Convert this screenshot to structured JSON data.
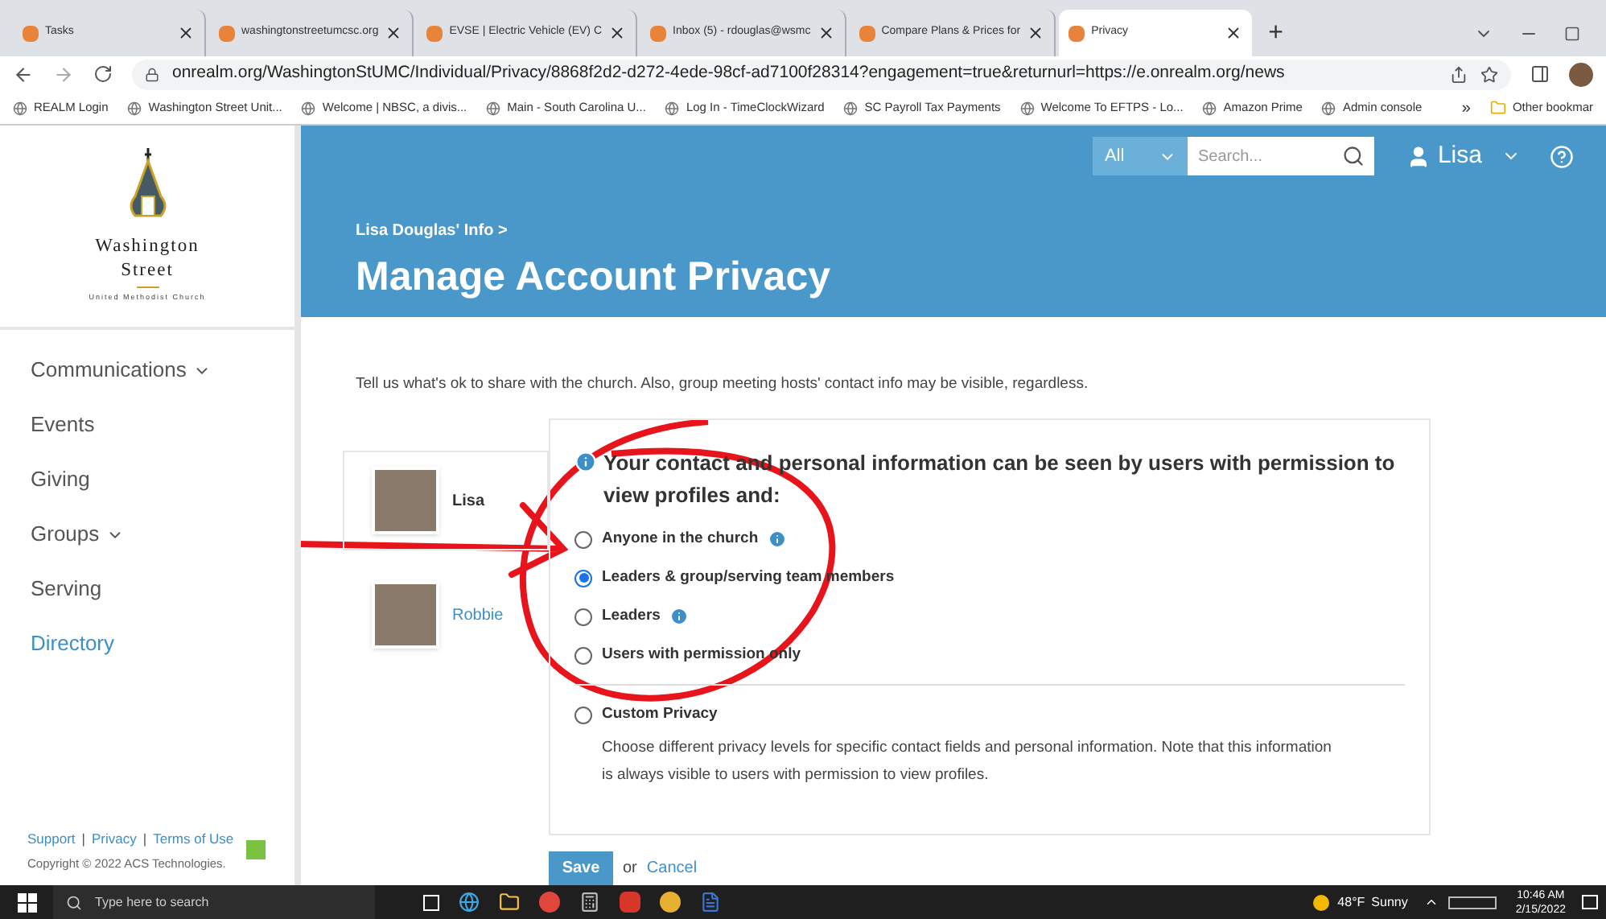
{
  "browser": {
    "tabs": [
      {
        "label": "Tasks",
        "selected": false
      },
      {
        "label": "washingtonstreetumcsc.org",
        "selected": false
      },
      {
        "label": "EVSE | Electric Vehicle (EV) C",
        "selected": false
      },
      {
        "label": "Inbox (5) - rdouglas@wsmc",
        "selected": false
      },
      {
        "label": "Compare Plans & Prices for",
        "selected": false
      },
      {
        "label": "Privacy",
        "selected": true
      }
    ],
    "new_tab": "+",
    "url": "onrealm.org/WashingtonStUMC/Individual/Privacy/8868f2d2-d272-4ede-98cf-ad7100f28314?engagement=true&returnurl=https://e.onrealm.org/news",
    "bookmarks": [
      "REALM Login",
      "Washington Street Unit...",
      "Welcome | NBSC, a divis...",
      "Main - South Carolina U...",
      "Log In - TimeClockWizard",
      "SC Payroll Tax Payments",
      "Welcome To EFTPS - Lo...",
      "Amazon Prime",
      "Admin console"
    ],
    "bookmarks_more": "»",
    "other_bookmarks": "Other bookmar"
  },
  "logo": {
    "line1": "Washington",
    "line2": "Street",
    "line3": "United Methodist Church"
  },
  "sidebar": {
    "items": [
      {
        "label": "Communications",
        "expandable": true,
        "selected": false
      },
      {
        "label": "Events",
        "expandable": false,
        "selected": false
      },
      {
        "label": "Giving",
        "expandable": false,
        "selected": false
      },
      {
        "label": "Groups",
        "expandable": true,
        "selected": false
      },
      {
        "label": "Serving",
        "expandable": false,
        "selected": false
      },
      {
        "label": "Directory",
        "expandable": false,
        "selected": true
      }
    ],
    "footer_links": [
      "Support",
      "Privacy",
      "Terms of Use"
    ],
    "footer_separator": "|",
    "copyright": "Copyright © 2022 ACS Technologies."
  },
  "header": {
    "scope": "All",
    "search_placeholder": "Search...",
    "user": "Lisa",
    "breadcrumb": "Lisa Douglas' Info >",
    "title": "Manage Account Privacy"
  },
  "intro": "Tell us what's ok to share with the church. Also, group meeting hosts' contact info may be visible, regardless.",
  "people": [
    {
      "name": "Lisa",
      "selected": true
    },
    {
      "name": "Robbie",
      "selected": false
    }
  ],
  "privacy": {
    "heading": "Your contact and personal information can be seen by users with permission to view profiles and:",
    "options": [
      {
        "label": "Anyone in the church",
        "selected": false,
        "info": true
      },
      {
        "label": "Leaders & group/serving team members",
        "selected": true,
        "info": false
      },
      {
        "label": "Leaders",
        "selected": false,
        "info": true
      },
      {
        "label": "Users with permission only",
        "selected": false,
        "info": false
      },
      {
        "label": "Custom Privacy",
        "selected": false,
        "info": false,
        "description": "Choose different privacy levels for specific contact fields and personal information. Note that this information is always visible to users with permission to view profiles."
      }
    ]
  },
  "actions": {
    "save": "Save",
    "or": "or",
    "cancel": "Cancel"
  },
  "taskbar": {
    "search_placeholder": "Type here to search",
    "temperature": "48°F",
    "weather": "Sunny",
    "time": "10:46 AM",
    "date": "2/15/2022"
  }
}
